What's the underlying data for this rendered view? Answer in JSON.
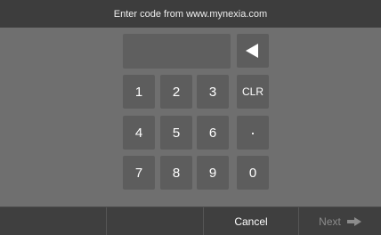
{
  "header": {
    "title": "Enter code from www.mynexia.com"
  },
  "code_display": {
    "value": ""
  },
  "keypad": {
    "backspace_icon": "backspace-triangle-icon",
    "k1": "1",
    "k2": "2",
    "k3": "3",
    "clr": "CLR",
    "k4": "4",
    "k5": "5",
    "k6": "6",
    "dot": "·",
    "k7": "7",
    "k8": "8",
    "k9": "9",
    "k0": "0"
  },
  "footer": {
    "slot1": "",
    "slot2": "",
    "cancel_label": "Cancel",
    "next_label": "Next",
    "next_icon": "arrow-right-icon"
  },
  "colors": {
    "background": "#6f6f6f",
    "bar": "#3d3d3d",
    "key": "#5d5d5d",
    "text": "#ffffff",
    "disabled": "#8c8c8c"
  }
}
